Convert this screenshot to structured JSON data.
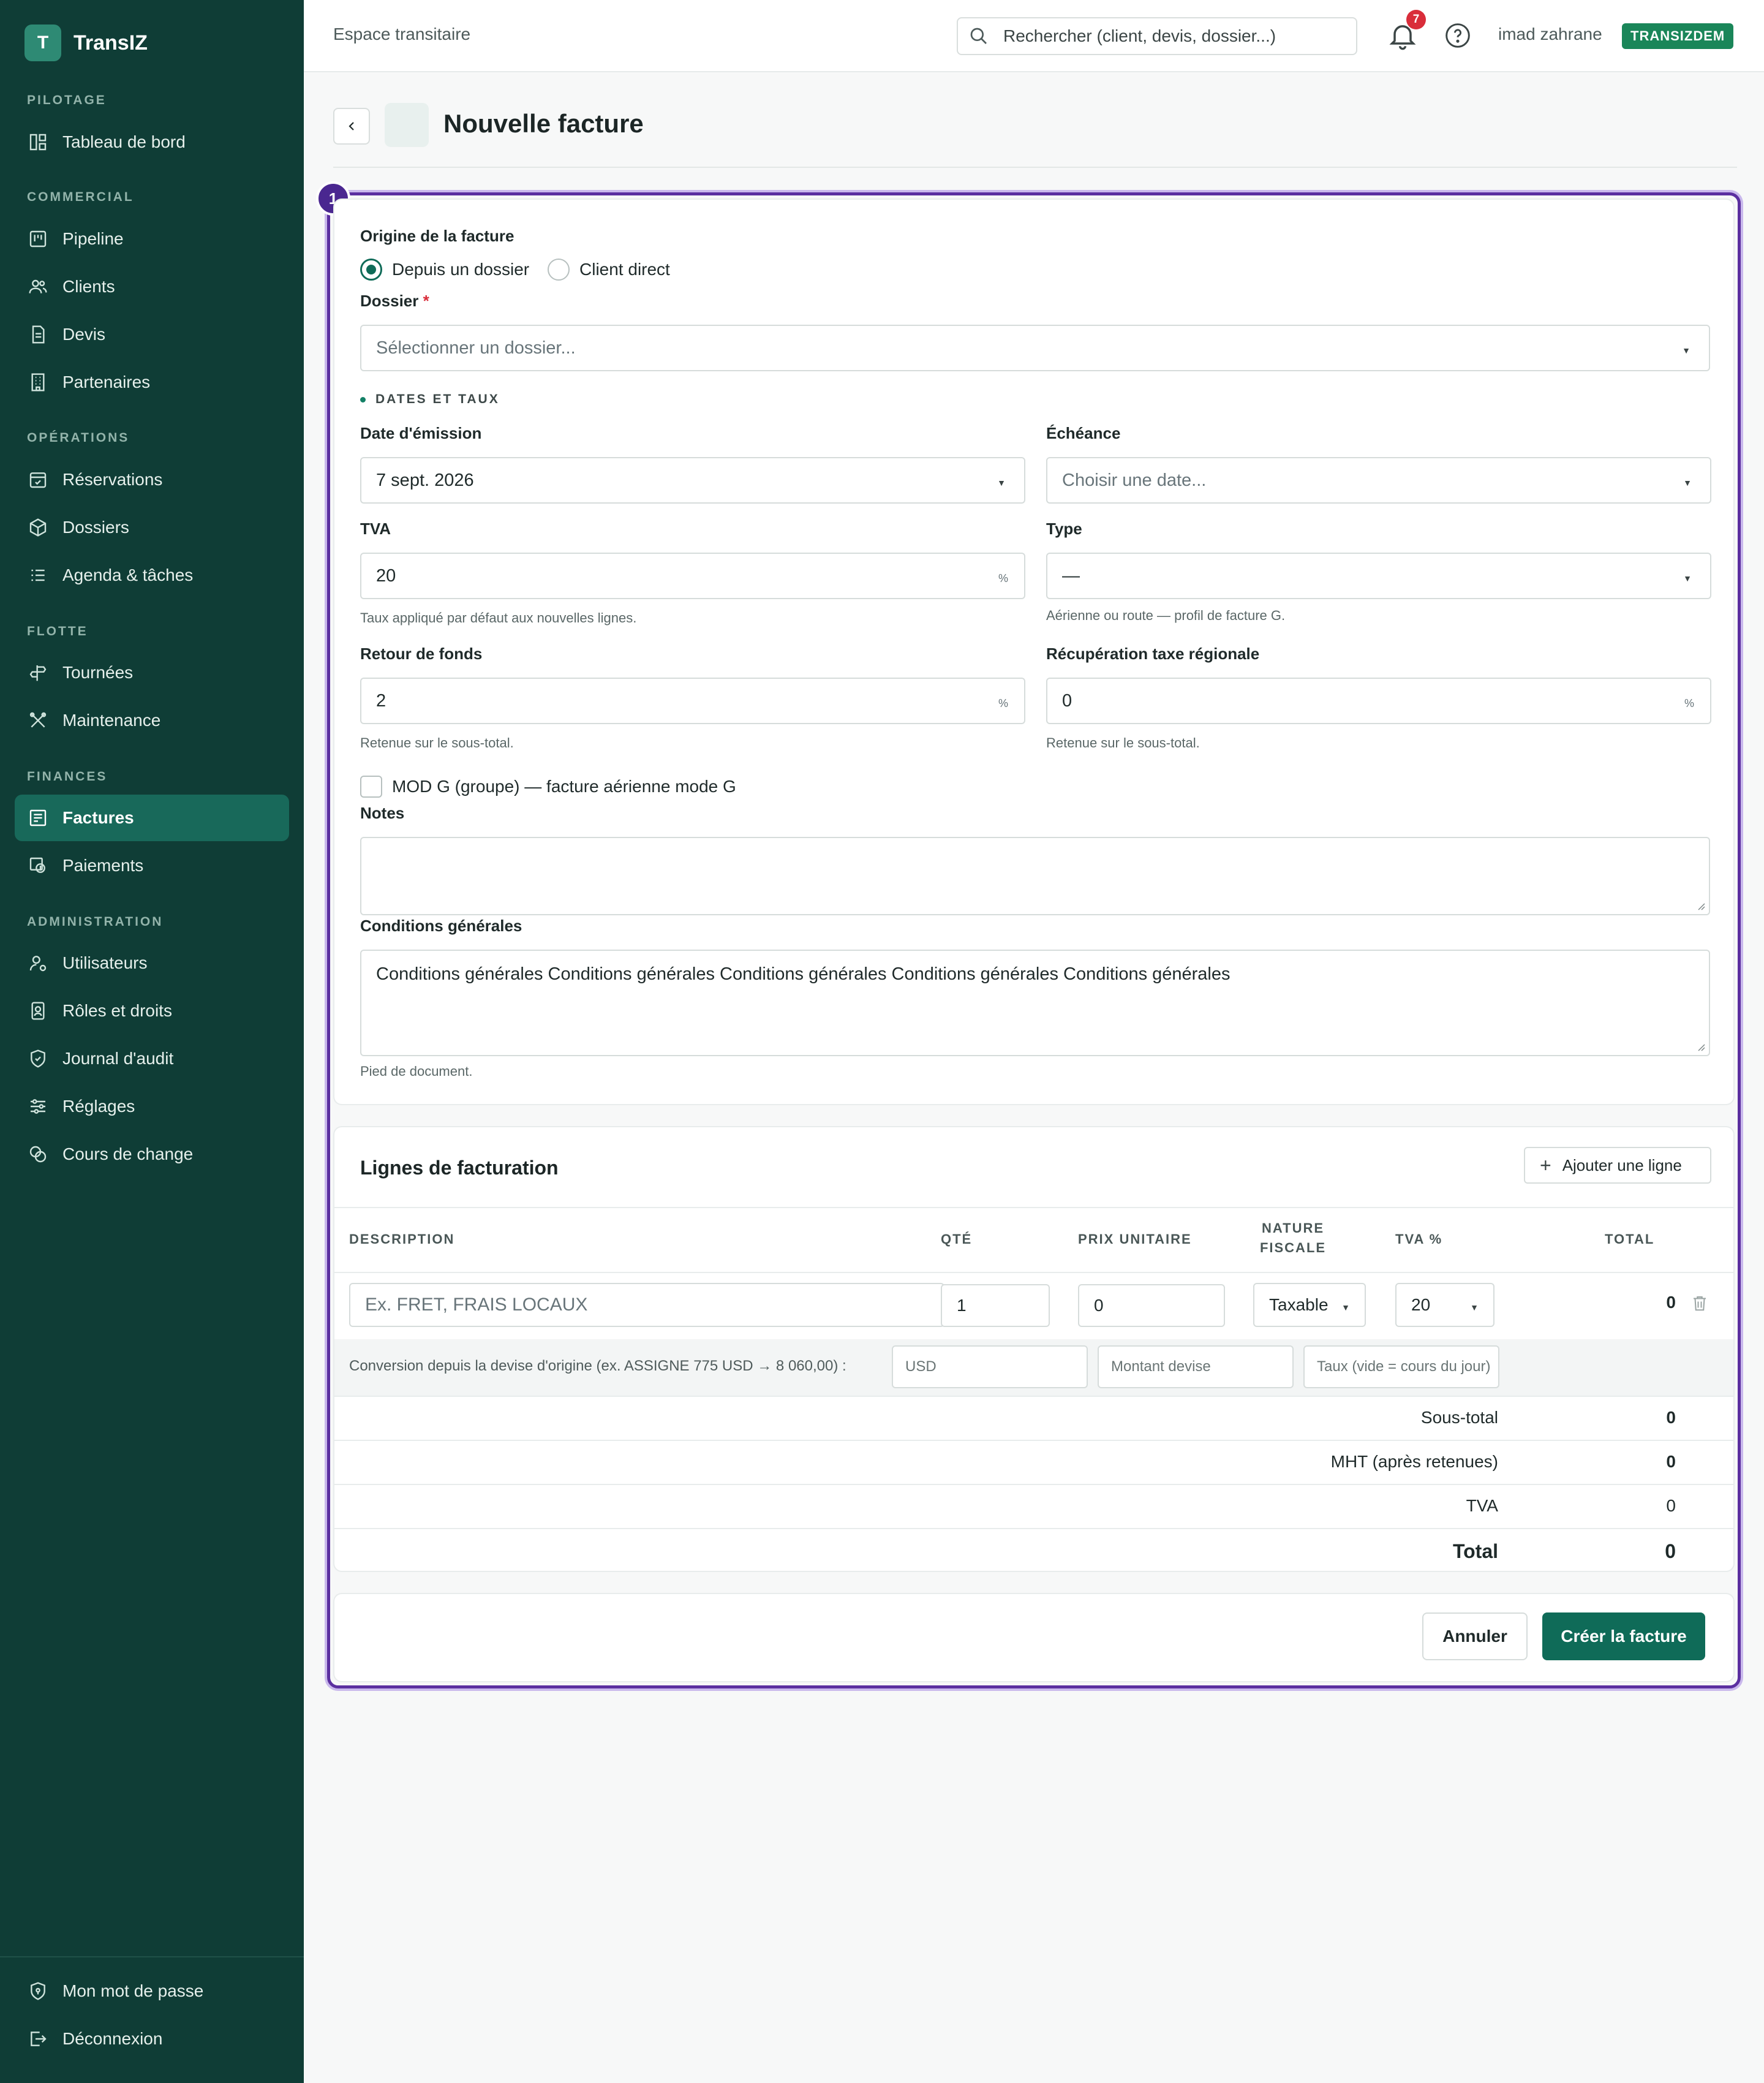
{
  "app": {
    "name": "TransIZ",
    "logo_letter": "T"
  },
  "sidebar": {
    "sections": {
      "pilotage": "PILOTAGE",
      "commercial": "COMMERCIAL",
      "operations": "OPÉRATIONS",
      "flotte": "FLOTTE",
      "finances": "FINANCES",
      "administration": "ADMINISTRATION"
    },
    "items": {
      "dashboard": "Tableau de bord",
      "pipeline": "Pipeline",
      "clients": "Clients",
      "devis": "Devis",
      "partenaires": "Partenaires",
      "reservations": "Réservations",
      "dossiers": "Dossiers",
      "agenda": "Agenda & tâches",
      "tournees": "Tournées",
      "maintenance": "Maintenance",
      "factures": "Factures",
      "paiements": "Paiements",
      "utilisateurs": "Utilisateurs",
      "roles": "Rôles et droits",
      "audit": "Journal d'audit",
      "reglages": "Réglages",
      "change": "Cours de change"
    },
    "footer": {
      "password": "Mon mot de passe",
      "logout": "Déconnexion"
    }
  },
  "topbar": {
    "title": "Espace transitaire",
    "search_placeholder": "Rechercher (client, devis, dossier...)",
    "notifications_count": "7",
    "user_name": "imad zahrane",
    "company_badge": "TRANSIZDEM"
  },
  "page": {
    "title": "Nouvelle facture",
    "step": "1"
  },
  "form": {
    "origin_label": "Origine de la facture",
    "origin_options": {
      "dossier": "Depuis un dossier",
      "client": "Client direct"
    },
    "dossier_label": "Dossier",
    "required_mark": "*",
    "dossier_placeholder": "Sélectionner un dossier...",
    "dates_section": "DATES ET TAUX",
    "date_emission_label": "Date d'émission",
    "date_emission_value": "7 sept. 2026",
    "echeance_label": "Échéance",
    "echeance_placeholder": "Choisir une date...",
    "tva_label": "TVA",
    "tva_value": "20",
    "tva_hint": "Taux appliqué par défaut aux nouvelles lignes.",
    "type_label": "Type",
    "type_value": "—",
    "type_hint": "Aérienne ou route — profil de facture G.",
    "retour_label": "Retour de fonds",
    "retour_value": "2",
    "retour_hint": "Retenue sur le sous-total.",
    "taxe_label": "Récupération taxe régionale",
    "taxe_value": "0",
    "taxe_hint": "Retenue sur le sous-total.",
    "percent_sign": "%",
    "modg_label": "MOD G (groupe) — facture aérienne mode G",
    "notes_label": "Notes",
    "notes_value": "",
    "conditions_label": "Conditions générales",
    "conditions_value": "Conditions générales Conditions générales Conditions générales Conditions générales Conditions générales",
    "conditions_hint": "Pied de document."
  },
  "lines": {
    "title": "Lignes de facturation",
    "add_button": "Ajouter une ligne",
    "columns": {
      "description": "DESCRIPTION",
      "qty": "QTÉ",
      "unit_price": "PRIX UNITAIRE",
      "nature_1": "NATURE",
      "nature_2": "FISCALE",
      "tva": "TVA %",
      "total": "TOTAL"
    },
    "row": {
      "description_placeholder": "Ex. FRET, FRAIS LOCAUX",
      "qty": "1",
      "unit_price": "0",
      "nature": "Taxable",
      "tva": "20",
      "total": "0"
    },
    "conversion": {
      "label": "Conversion depuis la devise d'origine (ex. ASSIGNE 775 USD → 8 060,00) :",
      "currency_placeholder": "USD",
      "amount_placeholder": "Montant devise",
      "rate_placeholder": "Taux (vide = cours du jour)"
    },
    "totals": {
      "subtotal_label": "Sous-total",
      "subtotal_value": "0",
      "mht_label": "MHT (après retenues)",
      "mht_value": "0",
      "tva_label": "TVA",
      "tva_value": "0",
      "total_label": "Total",
      "total_value": "0"
    }
  },
  "actions": {
    "cancel": "Annuler",
    "create": "Créer la facture"
  },
  "colors": {
    "sidebar": "#0f3d36",
    "primary": "#0f6b58",
    "active_nav": "#18695a",
    "focus": "#5b2fa0",
    "badge": "#1a8659"
  }
}
